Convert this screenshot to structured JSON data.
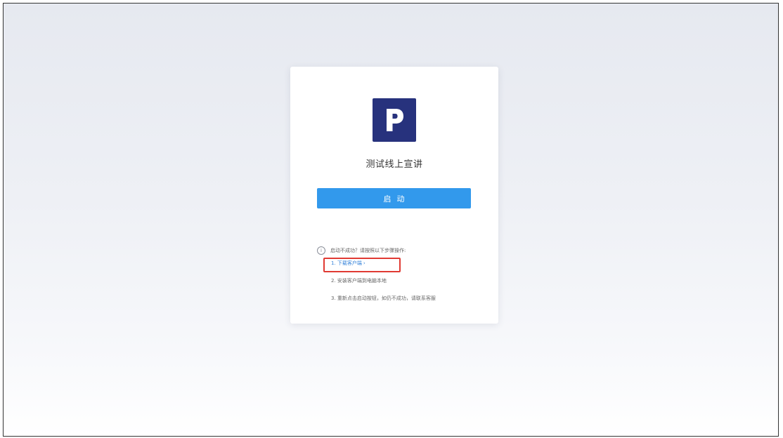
{
  "app": {
    "logo_letter": "P",
    "logo_color": "#27327d",
    "title": "测试线上宣讲"
  },
  "launch": {
    "label": "启动",
    "color": "#3299ec"
  },
  "help": {
    "icon": "info-icon",
    "heading": "启动不成功？请按照以下步骤操作:",
    "steps": [
      {
        "text": "1. 下载客户端",
        "chevron": "›",
        "link": true,
        "highlighted": true
      },
      {
        "text": "2. 安装客户端到电脑本地"
      },
      {
        "text": "3. 重新点击启动按钮，如仍不成功，请联系客服"
      }
    ]
  },
  "annotation": {
    "color": "#e03a33"
  }
}
